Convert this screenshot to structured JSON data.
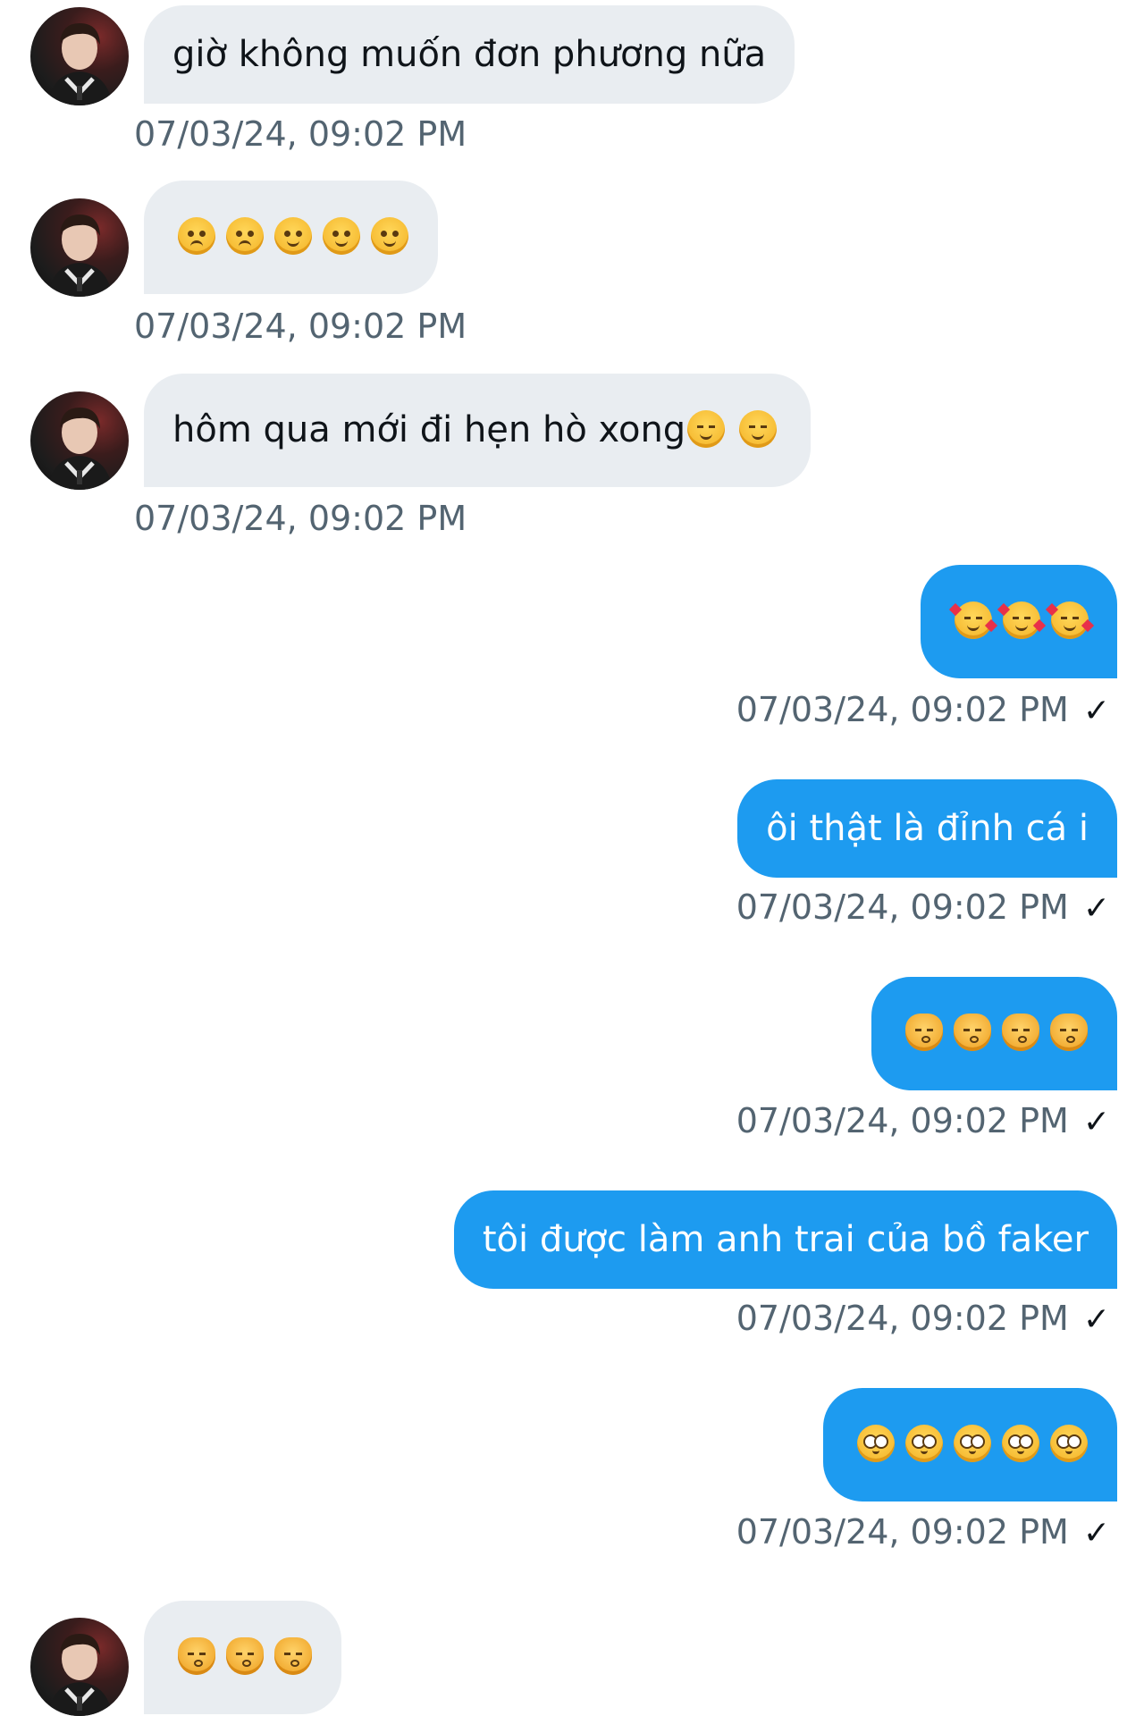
{
  "colors": {
    "incoming_bubble": "#e9edf1",
    "outgoing_bubble": "#1d9bf0",
    "timestamp": "#536471"
  },
  "messages": [
    {
      "direction": "in",
      "text": "giờ không muốn đơn phương nữa",
      "time": "07/03/24, 09:02 PM"
    },
    {
      "direction": "in",
      "emoji": [
        "weary-face",
        "weary-face",
        "yum-face",
        "yum-face",
        "yum-face"
      ],
      "time": "07/03/24, 09:02 PM"
    },
    {
      "direction": "in",
      "text": "hôm qua mới đi hẹn hò xong",
      "emoji": [
        "smiling-blush-face",
        "smiling-blush-face"
      ],
      "time": "07/03/24, 09:02 PM"
    },
    {
      "direction": "out",
      "emoji": [
        "smiling-face-with-hearts",
        "smiling-face-with-hearts",
        "smiling-face-with-hearts"
      ],
      "time": "07/03/24, 09:02 PM",
      "status": "✓"
    },
    {
      "direction": "out",
      "text": "ôi thật là đỉnh cá i",
      "time": "07/03/24, 09:02 PM",
      "status": "✓"
    },
    {
      "direction": "out",
      "emoji": [
        "kissing-cat",
        "kissing-cat",
        "kissing-cat",
        "kissing-cat"
      ],
      "time": "07/03/24, 09:02 PM",
      "status": "✓"
    },
    {
      "direction": "out",
      "text": "tôi được làm anh trai của bồ faker",
      "time": "07/03/24, 09:02 PM",
      "status": "✓"
    },
    {
      "direction": "out",
      "emoji": [
        "pleading-face",
        "pleading-face",
        "pleading-face",
        "pleading-face",
        "pleading-face"
      ],
      "time": "07/03/24, 09:02 PM",
      "status": "✓"
    },
    {
      "direction": "in",
      "emoji": [
        "kissing-cat",
        "kissing-cat",
        "kissing-cat"
      ],
      "time": ""
    }
  ]
}
